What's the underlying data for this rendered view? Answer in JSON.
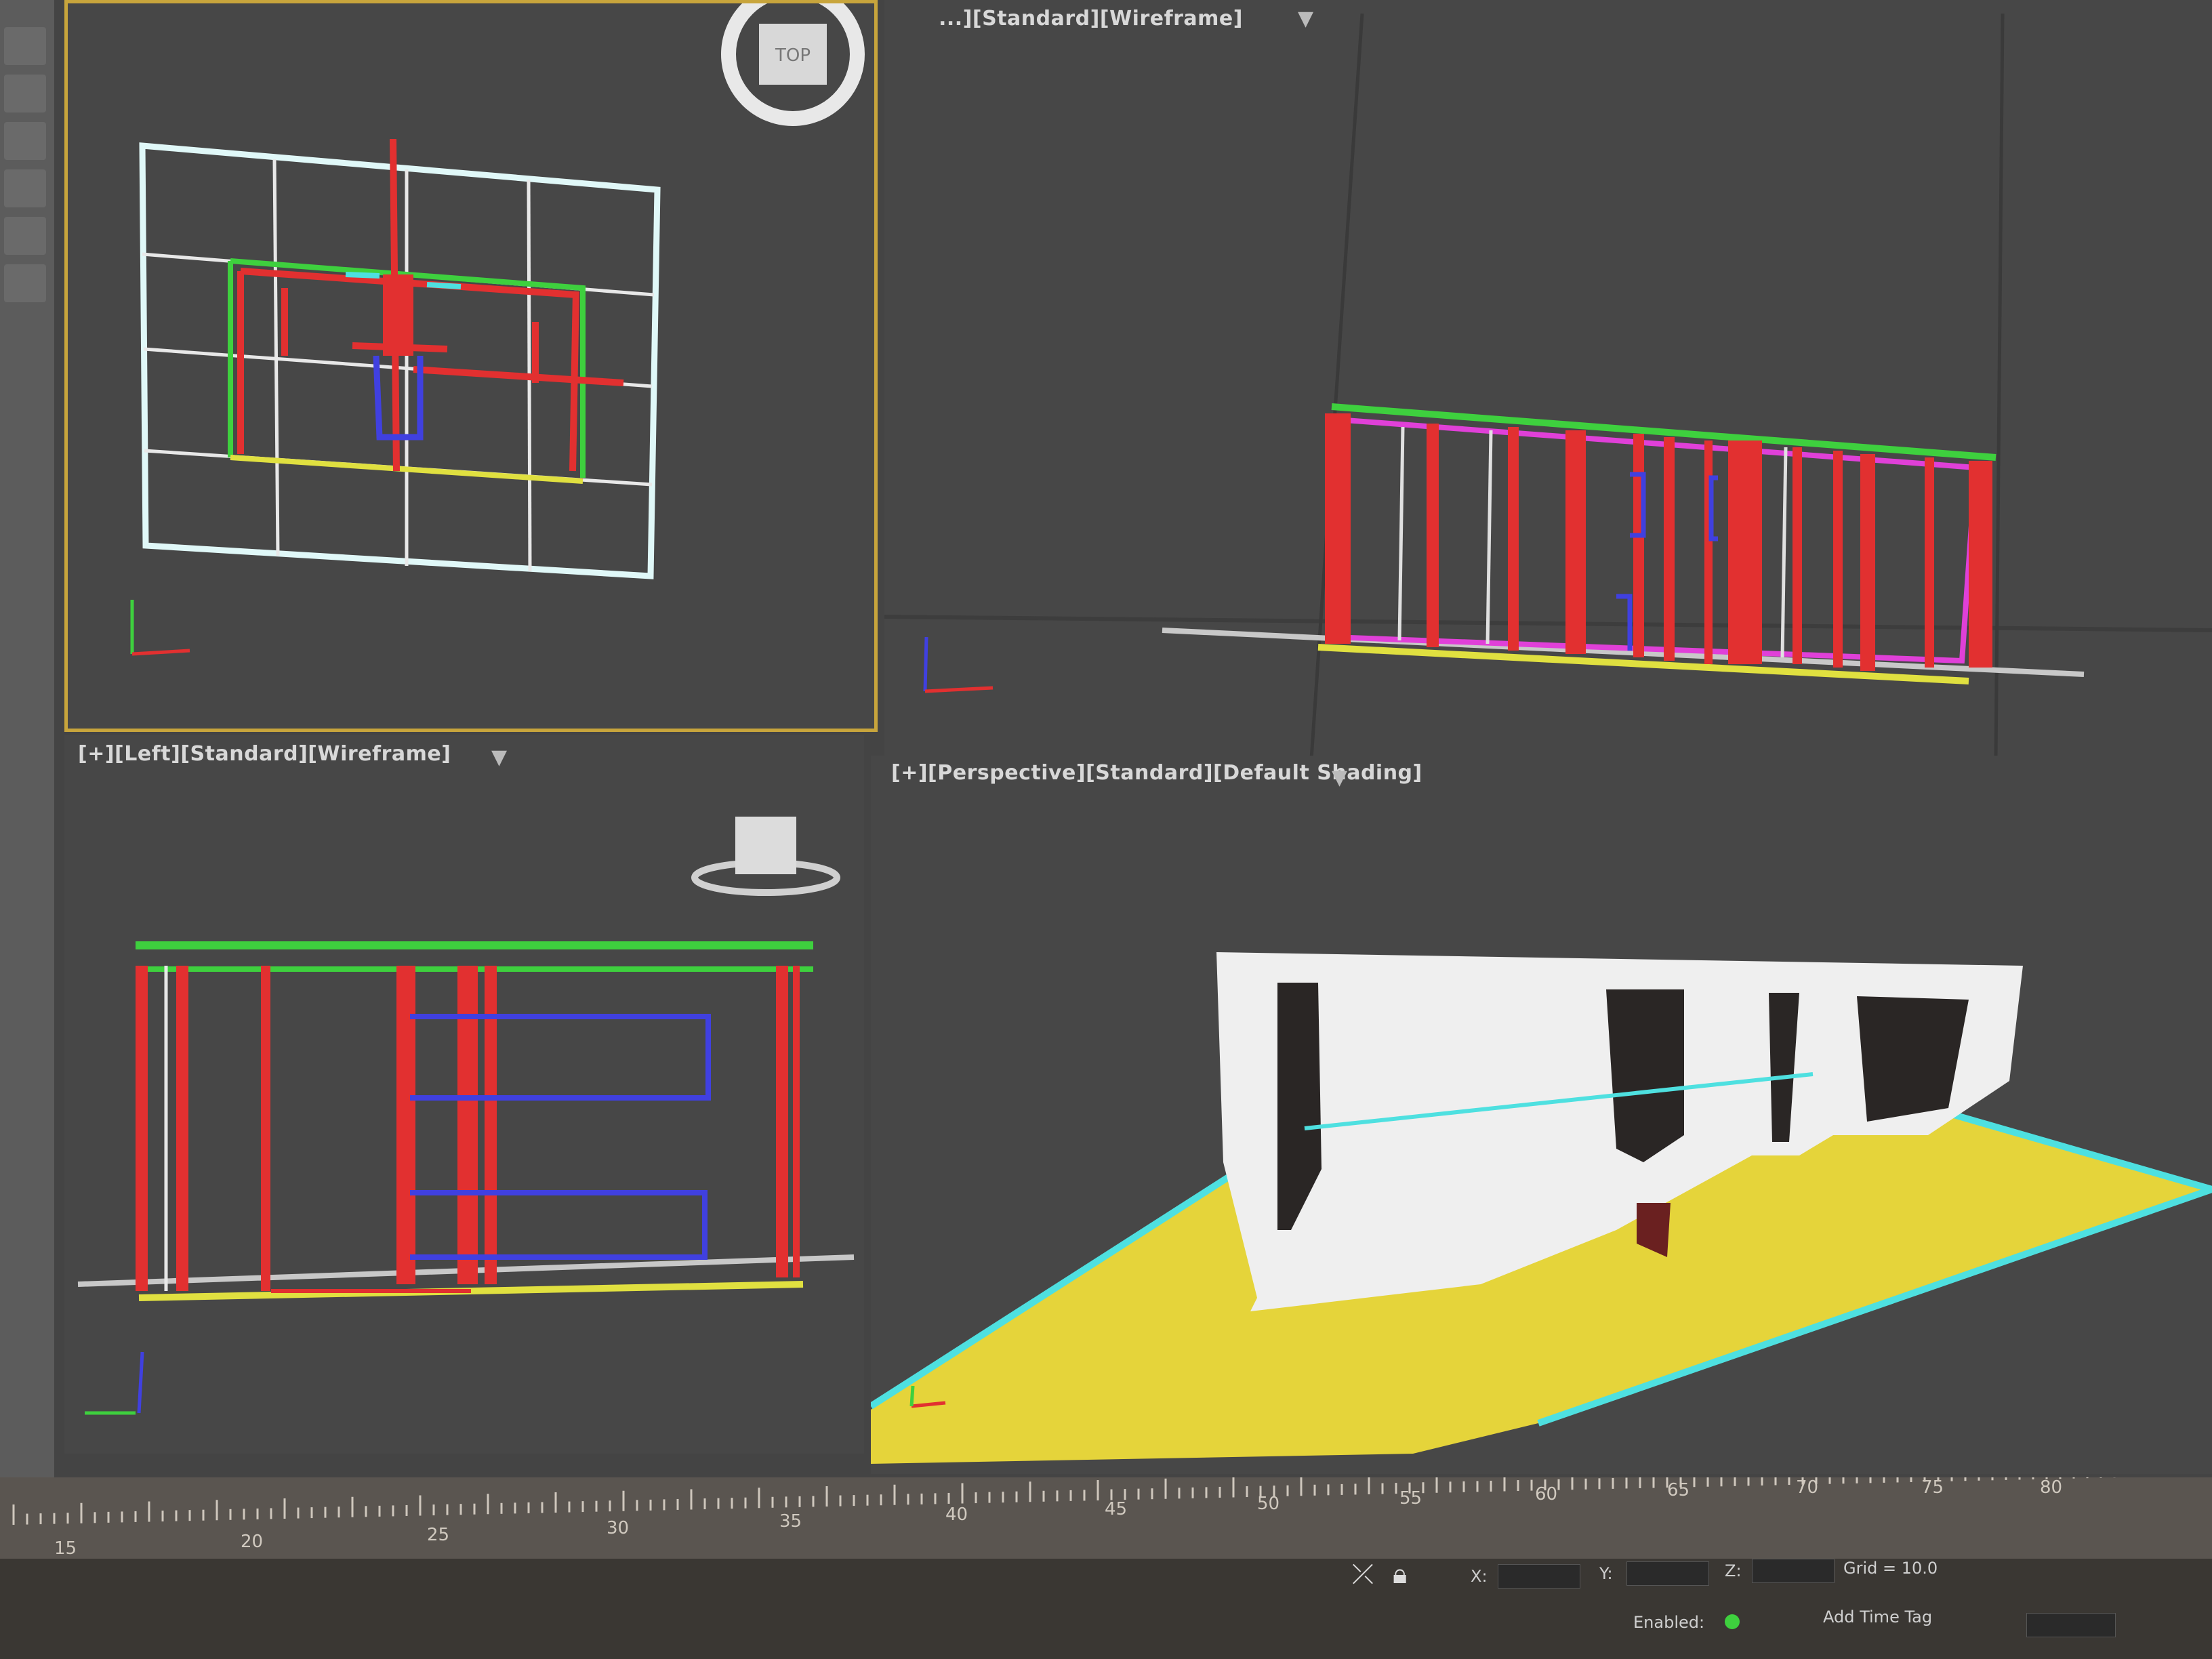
{
  "viewports": {
    "top": {
      "view": "Top",
      "shading": "Wireframe",
      "nav_label": "TOP"
    },
    "front": {
      "label": "[+][Front][Standard][Wireframe]",
      "visible_label": "...][Standard][Wireframe]"
    },
    "left": {
      "label": "[+][Left][Standard][Wireframe]"
    },
    "perspective": {
      "label": "[+][Perspective][Standard][Default Shading]"
    }
  },
  "colors": {
    "viewport_bg": "#474747",
    "active_border": "#c8a53c",
    "floor": "#e5d43a",
    "floor_edge": "#4ee0e0",
    "wall_white": "#efefef",
    "red": "#e23030",
    "green": "#3ed03e",
    "magenta": "#e040d8",
    "blue": "#4040e0",
    "yellow": "#e0e040"
  },
  "timeline": {
    "ticks": [
      "15",
      "20",
      "25",
      "30",
      "35",
      "40",
      "45",
      "50",
      "55",
      "60",
      "65",
      "70",
      "75",
      "80"
    ]
  },
  "status": {
    "x_label": "X:",
    "y_label": "Y:",
    "z_label": "Z:",
    "grid_text": "Grid = 10.0",
    "enabled_label": "Enabled:",
    "add_time_tag": "Add Time Tag"
  },
  "icons": {
    "filter": "filter-icon",
    "lock": "lock-icon",
    "select": "selection-icon"
  }
}
